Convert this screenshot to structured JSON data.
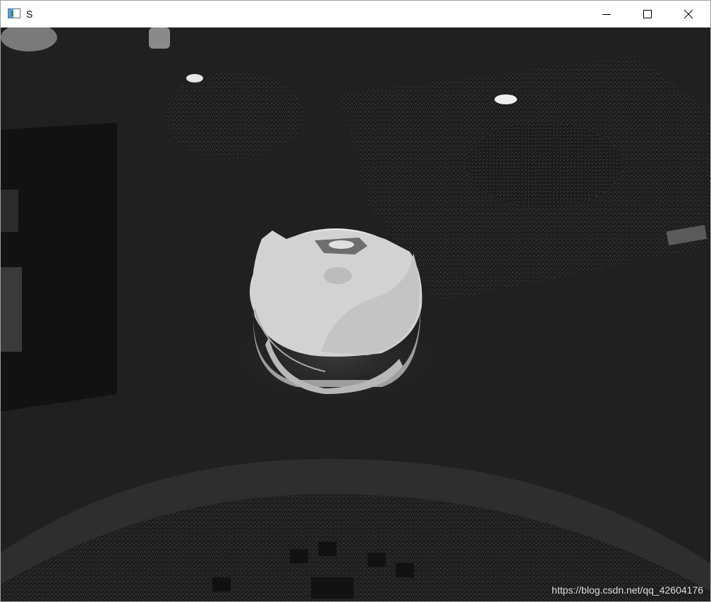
{
  "window": {
    "title": "S",
    "icons": {
      "app": "app-window-icon",
      "minimize": "minimize-icon",
      "maximize": "maximize-icon",
      "close": "close-icon"
    }
  },
  "image": {
    "watermark": "https://blog.csdn.net/qq_42604176",
    "description_colors": {
      "background": "#1f1f1f",
      "object": "#d8d8d8"
    }
  }
}
